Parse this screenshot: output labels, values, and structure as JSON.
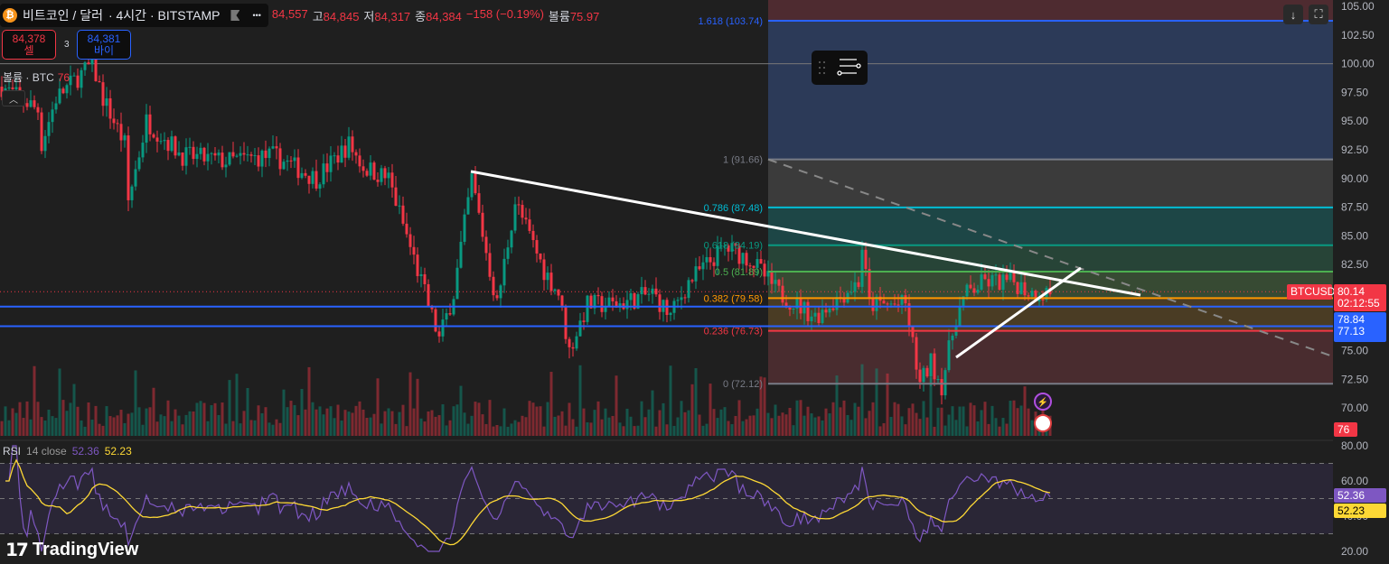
{
  "header": {
    "symbol": "비트코인 / 달러",
    "meta": "· 4시간 · BITSTAMP",
    "more": "•••",
    "open": "84,557",
    "high_label": "고",
    "high": "84,845",
    "low_label": "저",
    "low": "84,317",
    "close_label": "종",
    "close": "84,384",
    "change": "−158 (−0.19%)",
    "volume_label": "볼륨",
    "volume": "75.97"
  },
  "trade": {
    "sell_price": "84,378",
    "sell_label": "셀",
    "spread": "3",
    "buy_price": "84,381",
    "buy_label": "바이"
  },
  "volume_legend": {
    "label": "볼륨 · BTC",
    "value": "76"
  },
  "rsi_legend": {
    "label": "RSI",
    "params": "14 close",
    "rsi": "52.36",
    "ma": "52.23"
  },
  "brand": "TradingView",
  "price_axis": {
    "ticks": [
      "105.00",
      "102.50",
      "100.00",
      "97.50",
      "95.00",
      "92.50",
      "90.00",
      "87.50",
      "85.00",
      "82.50",
      "75.00",
      "72.50",
      "70.00"
    ],
    "symbol_tag": "BTCUSD",
    "last_price": "80.14",
    "countdown": "02:12:55",
    "level1": "78.84",
    "level2": "77.13",
    "volume_tag": "76"
  },
  "rsi_axis": {
    "ticks": [
      "80.00",
      "60.00",
      "40.00",
      "20.00"
    ],
    "rsi_tag": "52.36",
    "ma_tag": "52.23"
  },
  "colors": {
    "up": "#089981",
    "down": "#f23645",
    "blue": "#2962ff",
    "rsi": "#7e57c2",
    "rsi_ma": "#fdd835"
  },
  "chart_data": {
    "type": "candlestick",
    "price_range": [
      68.5,
      105.5
    ],
    "fib_levels": [
      {
        "ratio": "1.618",
        "price": 103.74,
        "label": "1.618 (103.74)",
        "color": "#2962ff"
      },
      {
        "ratio": "1",
        "price": 91.66,
        "label": "1 (91.66)",
        "color": "#787b86"
      },
      {
        "ratio": "0.786",
        "price": 87.48,
        "label": "0.786 (87.48)",
        "color": "#00bcd4"
      },
      {
        "ratio": "0.618",
        "price": 84.19,
        "label": "0.618 (84.19)",
        "color": "#089981"
      },
      {
        "ratio": "0.5",
        "price": 81.89,
        "label": "0.5 (81.89)",
        "color": "#4caf50"
      },
      {
        "ratio": "0.382",
        "price": 79.58,
        "label": "0.382 (79.58)",
        "color": "#ff9800"
      },
      {
        "ratio": "0.236",
        "price": 76.73,
        "label": "0.236 (76.73)",
        "color": "#f23645"
      },
      {
        "ratio": "0",
        "price": 72.12,
        "label": "0 (72.12)",
        "color": "#787b86"
      }
    ],
    "horizontal_lines": [
      100.0,
      78.84,
      77.13
    ],
    "last_price": 80.14,
    "price_path": [
      [
        0,
        98
      ],
      [
        10,
        96
      ],
      [
        11,
        93
      ],
      [
        15,
        97
      ],
      [
        25,
        100
      ],
      [
        28,
        97
      ],
      [
        34,
        93
      ],
      [
        35,
        88
      ],
      [
        40,
        95
      ],
      [
        50,
        92
      ],
      [
        62,
        91.5
      ],
      [
        75,
        92
      ],
      [
        87,
        90
      ],
      [
        96,
        93
      ],
      [
        100,
        91
      ],
      [
        107,
        90
      ],
      [
        111,
        86
      ],
      [
        117,
        80
      ],
      [
        121,
        76
      ],
      [
        125,
        80
      ],
      [
        130,
        90
      ],
      [
        135,
        82
      ],
      [
        137,
        79
      ],
      [
        142,
        88
      ],
      [
        150,
        82
      ],
      [
        154,
        80
      ],
      [
        157,
        75
      ],
      [
        162,
        79
      ],
      [
        170,
        79
      ],
      [
        180,
        80
      ],
      [
        185,
        78
      ],
      [
        190,
        81
      ],
      [
        200,
        84
      ],
      [
        207,
        83
      ],
      [
        215,
        80
      ],
      [
        225,
        78
      ],
      [
        237,
        81
      ],
      [
        238,
        84
      ],
      [
        240,
        79
      ],
      [
        250,
        79
      ],
      [
        254,
        72
      ],
      [
        257,
        74
      ],
      [
        260,
        72
      ],
      [
        264,
        78
      ],
      [
        267,
        80
      ],
      [
        272,
        81
      ],
      [
        280,
        81
      ],
      [
        285,
        80
      ],
      [
        290,
        80.1
      ]
    ],
    "rsi_range": [
      20,
      80
    ]
  }
}
